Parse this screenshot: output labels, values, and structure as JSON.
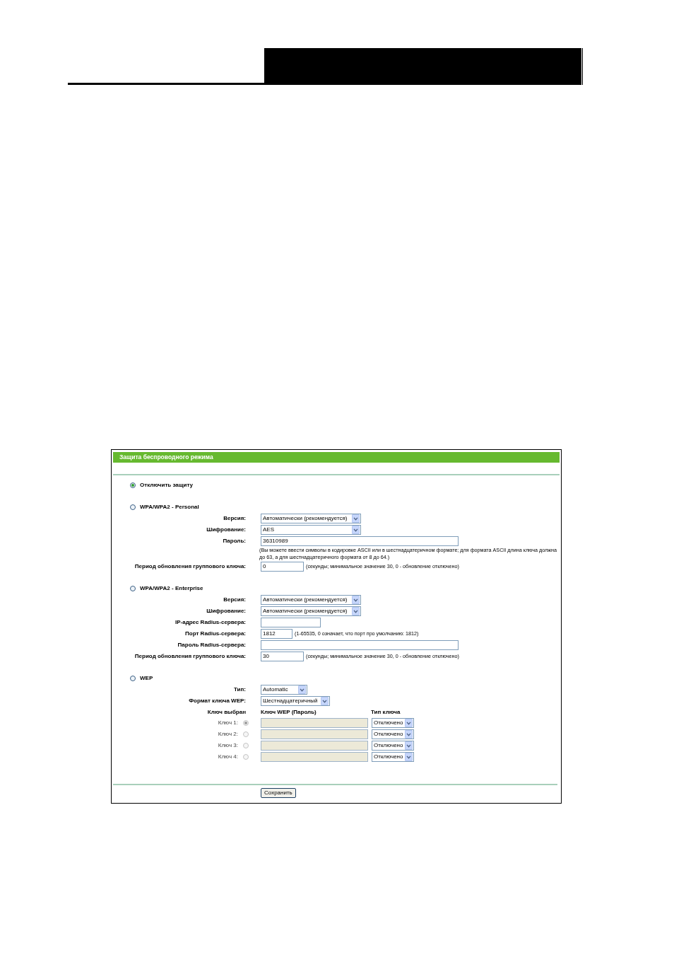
{
  "panel": {
    "title": "Защита беспроводного режима"
  },
  "modes": [
    {
      "label": "Отключить защиту",
      "selected": true
    },
    {
      "label": "WPA/WPA2 - Personal",
      "selected": false,
      "fields": [
        {
          "kind": "select",
          "label": "Версия:",
          "value": "Автоматически (рекомендуется)"
        },
        {
          "kind": "select",
          "label": "Шифрование:",
          "value": "AES"
        },
        {
          "kind": "input",
          "label": "Пароль:",
          "value": "36310989",
          "note": [
            "(Вы можете ввести символы в кодировке ASCII или в шестнадцатеричном формате; для формата ASCII длина ключа должна",
            "до 63, а для шестнадцатеричного формата от 8 до 64.)"
          ]
        },
        {
          "kind": "input",
          "label": "Период обновления группового ключа:",
          "value": "0",
          "hint": "(секунды; минимальное значение 30, 0 - обновление отключено)"
        }
      ]
    },
    {
      "label": "WPA/WPA2 - Enterprise",
      "selected": false,
      "fields": [
        {
          "kind": "select",
          "label": "Версия:",
          "value": "Автоматически (рекомендуется)"
        },
        {
          "kind": "select",
          "label": "Шифрование:",
          "value": "Автоматически (рекомендуется)"
        },
        {
          "kind": "input",
          "label": "IP-адрес Radius-сервера:"
        },
        {
          "kind": "input",
          "label": "Порт Radius-сервера:",
          "value": "1812",
          "hint": "(1-65535, 0 означает, что порт про умолчанию: 1812)"
        },
        {
          "kind": "input",
          "label": "Пароль Radius-сервера:"
        },
        {
          "kind": "input",
          "label": "Период обновления группового ключа:",
          "value": "30",
          "hint": "(секунды; минимальное значение 30, 0 - обновление отключено)"
        }
      ]
    },
    {
      "label": "WEP",
      "selected": false,
      "fields": [
        {
          "kind": "select",
          "label": "Тип:",
          "value": "Automatic"
        },
        {
          "kind": "select",
          "label": "Формат ключа WEP:",
          "value": "Шестнадцатеричный"
        }
      ],
      "key_table": {
        "columns": [
          "Ключ выбран",
          "Ключ WEP (Пароль)",
          "Тип ключа"
        ],
        "keys": [
          {
            "label": "Ключ 1:",
            "selected": true,
            "disabled": true,
            "type": "Отключено"
          },
          {
            "label": "Ключ 2:",
            "selected": false,
            "disabled": true,
            "type": "Отключено"
          },
          {
            "label": "Ключ 3:",
            "selected": false,
            "disabled": true,
            "type": "Отключено"
          },
          {
            "label": "Ключ 4:",
            "selected": false,
            "disabled": true,
            "type": "Отключено"
          }
        ]
      }
    }
  ],
  "save_button": "Сохранить"
}
